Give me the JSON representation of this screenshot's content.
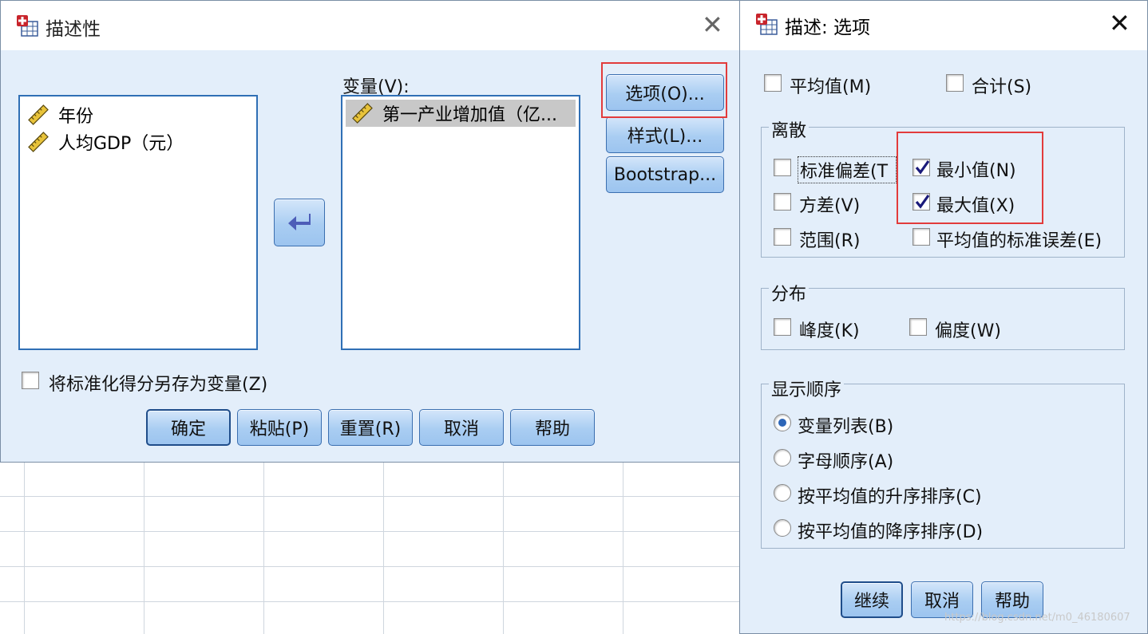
{
  "main_dialog": {
    "title": "描述性",
    "source_vars": [
      "年份",
      "人均GDP（元）"
    ],
    "variables_label": "变量(V):",
    "selected_vars": [
      "第一产业增加值（亿..."
    ],
    "side_buttons": {
      "options": "选项(O)...",
      "style": "样式(L)...",
      "bootstrap": "Bootstrap..."
    },
    "save_standardized_label": "将标准化得分另存为变量(Z)",
    "save_standardized_checked": false,
    "bottom_buttons": {
      "ok": "确定",
      "paste": "粘贴(P)",
      "reset": "重置(R)",
      "cancel": "取消",
      "help": "帮助"
    }
  },
  "options_dialog": {
    "title": "描述: 选项",
    "mean": {
      "label": "平均值(M)",
      "checked": false
    },
    "sum": {
      "label": "合计(S)",
      "checked": false
    },
    "dispersion": {
      "title": "离散",
      "std_dev": {
        "label": "标准偏差(T",
        "checked": false
      },
      "minimum": {
        "label": "最小值(N)",
        "checked": true
      },
      "variance": {
        "label": "方差(V)",
        "checked": false
      },
      "maximum": {
        "label": "最大值(X)",
        "checked": true
      },
      "range": {
        "label": "范围(R)",
        "checked": false
      },
      "se_mean": {
        "label": "平均值的标准误差(E)",
        "checked": false
      }
    },
    "distribution": {
      "title": "分布",
      "kurtosis": {
        "label": "峰度(K)",
        "checked": false
      },
      "skewness": {
        "label": "偏度(W)",
        "checked": false
      }
    },
    "display_order": {
      "title": "显示顺序",
      "selected": "variable_list",
      "options": [
        {
          "id": "variable_list",
          "label": "变量列表(B)"
        },
        {
          "id": "alphabetic",
          "label": "字母顺序(A)"
        },
        {
          "id": "ascending",
          "label": "按平均值的升序排序(C)"
        },
        {
          "id": "descending",
          "label": "按平均值的降序排序(D)"
        }
      ]
    },
    "buttons": {
      "continue": "继续",
      "cancel": "取消",
      "help": "帮助"
    }
  },
  "watermark": "https://blog.csdn.net/m0_46180607",
  "colors": {
    "accent": "#2d66b8",
    "highlight_box": "#e23b3b",
    "dialog_bg": "#e3eefa"
  }
}
